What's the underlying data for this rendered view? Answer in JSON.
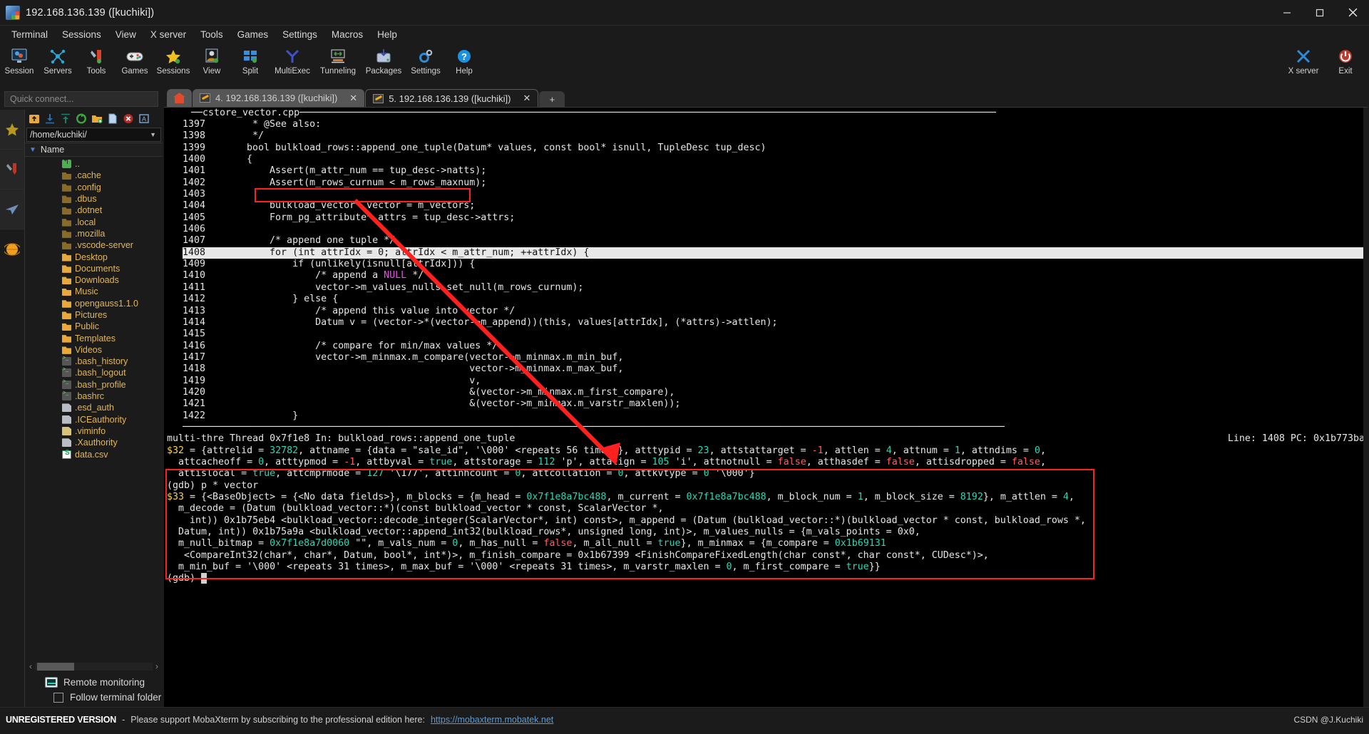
{
  "window": {
    "title": "192.168.136.139 ([kuchiki])",
    "icon": "mobaxterm-icon",
    "buttons": {
      "minimize": "minimize-button",
      "maximize": "maximize-button",
      "close": "close-button"
    }
  },
  "menubar": [
    "Terminal",
    "Sessions",
    "View",
    "X server",
    "Tools",
    "Games",
    "Settings",
    "Macros",
    "Help"
  ],
  "toolbar": {
    "items": [
      {
        "label": "Session",
        "icon": "session-icon"
      },
      {
        "label": "Servers",
        "icon": "servers-icon"
      },
      {
        "label": "Tools",
        "icon": "tools-icon"
      },
      {
        "label": "Games",
        "icon": "games-icon"
      },
      {
        "label": "Sessions",
        "icon": "sessions-star-icon"
      },
      {
        "label": "View",
        "icon": "view-icon"
      },
      {
        "label": "Split",
        "icon": "split-icon"
      },
      {
        "label": "MultiExec",
        "icon": "multiexec-icon"
      },
      {
        "label": "Tunneling",
        "icon": "tunneling-icon"
      },
      {
        "label": "Packages",
        "icon": "packages-icon"
      },
      {
        "label": "Settings",
        "icon": "settings-gear-icon"
      },
      {
        "label": "Help",
        "icon": "help-question-icon"
      }
    ],
    "right": [
      {
        "label": "X server",
        "icon": "x-server-icon"
      },
      {
        "label": "Exit",
        "icon": "exit-power-icon"
      }
    ]
  },
  "sidebar": {
    "quick_connect_placeholder": "Quick connect...",
    "rail": [
      "favorites-star-icon",
      "tools-knife-icon",
      "send-plane-icon",
      "globe-icon"
    ],
    "sftp_tools": [
      "go-up-icon",
      "download-icon",
      "upload-icon",
      "refresh-icon",
      "new-folder-icon",
      "new-file-icon",
      "delete-icon",
      "select-icon"
    ],
    "path": "/home/kuchiki/",
    "column_header": "Name",
    "files": [
      {
        "name": "..",
        "type": "up"
      },
      {
        "name": ".cache",
        "type": "folder-dim"
      },
      {
        "name": ".config",
        "type": "folder-dim"
      },
      {
        "name": ".dbus",
        "type": "folder-dim"
      },
      {
        "name": ".dotnet",
        "type": "folder-dim"
      },
      {
        "name": ".local",
        "type": "folder-dim"
      },
      {
        "name": ".mozilla",
        "type": "folder-dim"
      },
      {
        "name": ".vscode-server",
        "type": "folder-dim"
      },
      {
        "name": "Desktop",
        "type": "folder"
      },
      {
        "name": "Documents",
        "type": "folder"
      },
      {
        "name": "Downloads",
        "type": "folder"
      },
      {
        "name": "Music",
        "type": "folder"
      },
      {
        "name": "opengauss1.1.0",
        "type": "folder"
      },
      {
        "name": "Pictures",
        "type": "folder"
      },
      {
        "name": "Public",
        "type": "folder"
      },
      {
        "name": "Templates",
        "type": "folder"
      },
      {
        "name": "Videos",
        "type": "folder"
      },
      {
        "name": ".bash_history",
        "type": "shell"
      },
      {
        "name": ".bash_logout",
        "type": "shell"
      },
      {
        "name": ".bash_profile",
        "type": "shell"
      },
      {
        "name": ".bashrc",
        "type": "shell"
      },
      {
        "name": ".esd_auth",
        "type": "doc"
      },
      {
        "name": ".ICEauthority",
        "type": "doc"
      },
      {
        "name": ".viminfo",
        "type": "doc-pen"
      },
      {
        "name": ".Xauthority",
        "type": "doc"
      },
      {
        "name": "data.csv",
        "type": "csv"
      }
    ],
    "remote_monitoring": "Remote monitoring",
    "follow_terminal_folder": "Follow terminal folder"
  },
  "tabs": {
    "home_label": "",
    "items": [
      {
        "label": "4. 192.168.136.139 ([kuchiki])",
        "active": false,
        "closeable": true
      },
      {
        "label": "5. 192.168.136.139 ([kuchiki])",
        "active": true,
        "closeable": true
      }
    ],
    "new_tab_label": "+"
  },
  "terminal": {
    "source_file": "cstore_vector.cpp",
    "current_line_marker": ">",
    "code": [
      {
        "no": "1397",
        "text": "     * @See also:"
      },
      {
        "no": "1398",
        "text": "     */"
      },
      {
        "no": "1399",
        "text": "    bool bulkload_rows::append_one_tuple(Datum* values, const bool* isnull, TupleDesc tup_desc)"
      },
      {
        "no": "1400",
        "text": "    {"
      },
      {
        "no": "1401",
        "text": "        Assert(m_attr_num == tup_desc->natts);"
      },
      {
        "no": "1402",
        "text": "        Assert(m_rows_curnum < m_rows_maxnum);"
      },
      {
        "no": "1403",
        "text": ""
      },
      {
        "no": "1404",
        "text": "        bulkload_vector* vector = m_vectors;"
      },
      {
        "no": "1405",
        "text": "        Form_pg_attribute* attrs = tup_desc->attrs;"
      },
      {
        "no": "1406",
        "text": ""
      },
      {
        "no": "1407",
        "text": "        /* append one tuple */"
      },
      {
        "no": "1408",
        "text": "        for (int attrIdx = 0; attrIdx < m_attr_num; ++attrIdx) {",
        "current": true
      },
      {
        "no": "1409",
        "text": "            if (unlikely(isnull[attrIdx])) {"
      },
      {
        "no": "1410",
        "text": "                /* append a NULL */"
      },
      {
        "no": "1411",
        "text": "                vector->m_values_nulls.set_null(m_rows_curnum);"
      },
      {
        "no": "1412",
        "text": "            } else {"
      },
      {
        "no": "1413",
        "text": "                /* append this value into vector */"
      },
      {
        "no": "1414",
        "text": "                Datum v = (vector->*(vector->m_append))(this, values[attrIdx], (*attrs)->attlen);"
      },
      {
        "no": "1415",
        "text": ""
      },
      {
        "no": "1416",
        "text": "                /* compare for min/max values */"
      },
      {
        "no": "1417",
        "text": "                vector->m_minmax.m_compare(vector->m_minmax.m_min_buf,"
      },
      {
        "no": "1418",
        "text": "                                           vector->m_minmax.m_max_buf,"
      },
      {
        "no": "1419",
        "text": "                                           v,"
      },
      {
        "no": "1420",
        "text": "                                           &(vector->m_minmax.m_first_compare),"
      },
      {
        "no": "1421",
        "text": "                                           &(vector->m_minmax.m_varstr_maxlen));"
      },
      {
        "no": "1422",
        "text": "            }"
      }
    ],
    "status_left": "multi-thre Thread 0x7f1e8 In: bulkload_rows::append_one_tuple",
    "status_right": "Line: 1408 PC: 0x1b773ba",
    "gdb_output": [
      "$32 = {attrelid = 32782, attname = {data = \"sale_id\", '\\000' <repeats 56 times>}, atttypid = 23, attstattarget = -1, attlen = 4, attnum = 1, attndims = 0,",
      "  attcacheoff = 0, atttypmod = -1, attbyval = true, attstorage = 112 'p', attalign = 105 'i', attnotnull = false, atthasdef = false, attisdropped = false,",
      "  attislocal = true, attcmprmode = 127 '\\177', attinhcount = 0, attcollation = 0, attkvtype = 0 '\\000'}",
      "(gdb) p * vector",
      "$33 = {<BaseObject> = {<No data fields>}, m_blocks = {m_head = 0x7f1e8a7bc488, m_current = 0x7f1e8a7bc488, m_block_num = 1, m_block_size = 8192}, m_attlen = 4,",
      "  m_decode = (Datum (bulkload_vector::*)(const bulkload_vector * const, ScalarVector *,",
      "    int)) 0x1b75eb4 <bulkload_vector::decode_integer(ScalarVector*, int) const>, m_append = (Datum (bulkload_vector::*)(bulkload_vector * const, bulkload_rows *,",
      "",
      "  Datum, int)) 0x1b75a9a <bulkload_vector::append_int32(bulkload_rows*, unsigned long, int)>, m_values_nulls = {m_vals_points = 0x0,",
      "  m_null_bitmap = 0x7f1e8a7d0060 \"\", m_vals_num = 0, m_has_null = false, m_all_null = true}, m_minmax = {m_compare = 0x1b69131",
      "   <CompareInt32(char*, char*, Datum, bool*, int*)>, m_finish_compare = 0x1b67399 <FinishCompareFixedLength(char const*, char const*, CUDesc*)>,",
      "  m_min_buf = '\\000' <repeats 31 times>, m_max_buf = '\\000' <repeats 31 times>, m_varstr_maxlen = 0, m_first_compare = true}}",
      "(gdb) "
    ]
  },
  "annotations": {
    "highlight_code_line": "1404",
    "arrow": "red-arrow-pointing-from-line-1404-to-gdb-output",
    "highlight_box": "gdb-vector-output-box"
  },
  "bottom_bar": {
    "unregistered": "UNREGISTERED VERSION",
    "dash": "-",
    "message": "Please support MobaXterm by subscribing to the professional edition here:",
    "link": "https://mobaxterm.mobatek.net",
    "watermark": "CSDN @J.Kuchiki"
  },
  "colors": {
    "accent_blue": "#3b7fd4",
    "red_annotation": "#ff2020",
    "terminal_bg": "#000000",
    "chrome_bg": "#1b1b1b"
  }
}
